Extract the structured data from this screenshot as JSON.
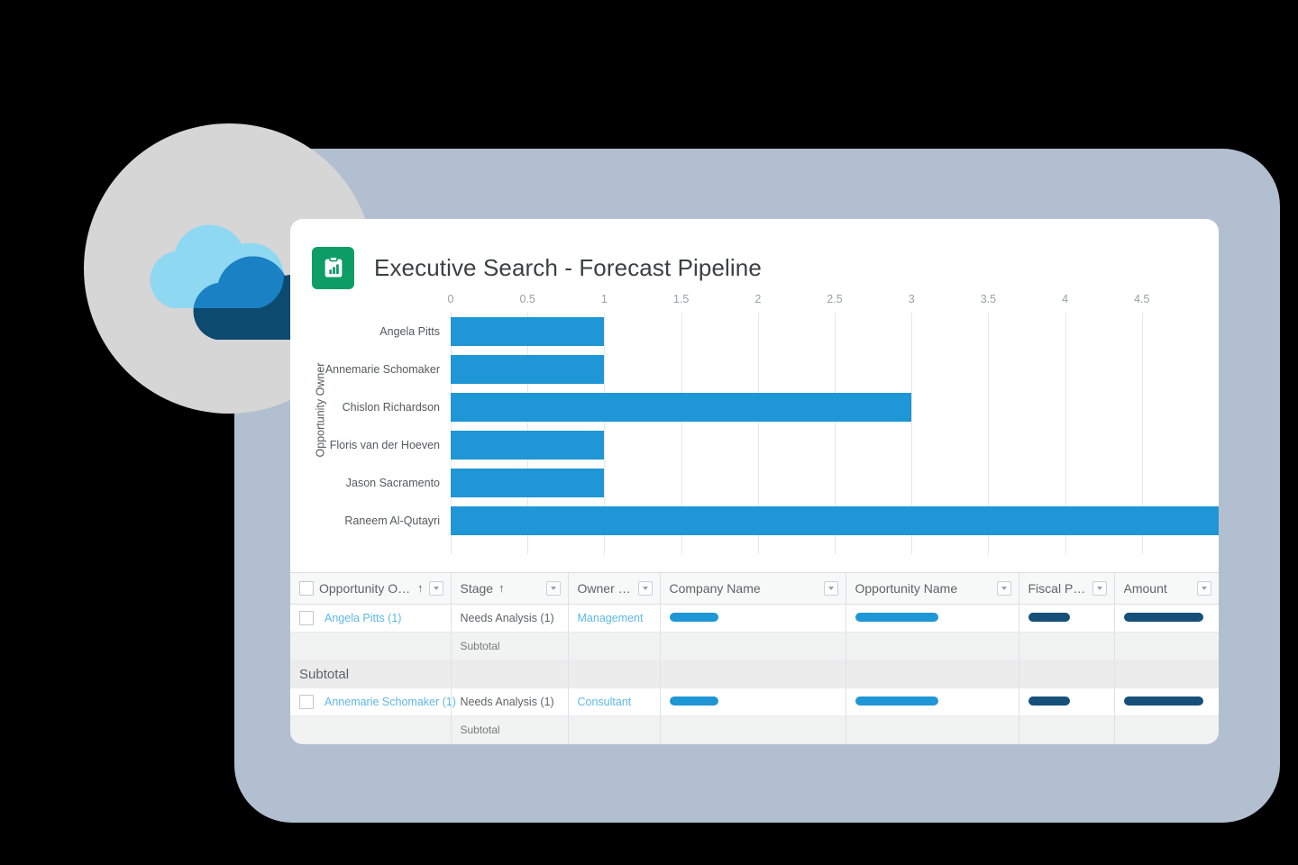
{
  "report": {
    "title": "Executive Search - Forecast Pipeline",
    "icon": "report-clipboard-chart-icon",
    "icon_color": "#0f9d67"
  },
  "theme": {
    "page_background": "#000000",
    "backdrop": "#b2bfd0",
    "circle": "#d6d6d6",
    "card": "#ffffff",
    "bar_blue": "#1f96d6",
    "link_blue": "#5db8e8",
    "pill_dark": "#165079",
    "cloud_light": "#8ed8f2",
    "cloud_mid": "#1a82c4",
    "cloud_dark": "#0d4a70"
  },
  "chart_data": {
    "type": "bar",
    "orientation": "horizontal",
    "title": "Executive Search - Forecast Pipeline",
    "xlabel": "",
    "ylabel": "Opportunity Owner",
    "xlim": [
      0,
      5
    ],
    "xticks": [
      "0",
      "0.5",
      "1",
      "1.5",
      "2",
      "2.5",
      "3",
      "3.5",
      "4",
      "4.5"
    ],
    "xtick_values": [
      0,
      0.5,
      1,
      1.5,
      2,
      2.5,
      3,
      3.5,
      4,
      4.5
    ],
    "grid": true,
    "legend": false,
    "categories": [
      "Angela Pitts",
      "Annemarie Schomaker",
      "Chislon Richardson",
      "Floris van der Hoeven",
      "Jason Sacramento",
      "Raneem Al-Qutayri"
    ],
    "values": [
      1,
      1,
      3,
      1,
      1,
      5
    ]
  },
  "table": {
    "columns": [
      {
        "label": "Opportunity Owner",
        "sorted": true,
        "sort_dir": "↑",
        "has_checkbox": true,
        "has_menu": true
      },
      {
        "label": "Stage",
        "sorted": true,
        "sort_dir": "↑",
        "has_checkbox": false,
        "has_menu": true
      },
      {
        "label": "Owner Role",
        "sorted": false,
        "sort_dir": "",
        "has_checkbox": false,
        "has_menu": true
      },
      {
        "label": "Company Name",
        "sorted": false,
        "sort_dir": "",
        "has_checkbox": false,
        "has_menu": true
      },
      {
        "label": "Opportunity Name",
        "sorted": false,
        "sort_dir": "",
        "has_checkbox": false,
        "has_menu": true
      },
      {
        "label": "Fiscal Period",
        "sorted": false,
        "sort_dir": "",
        "has_checkbox": false,
        "has_menu": true
      },
      {
        "label": "Amount",
        "sorted": false,
        "sort_dir": "",
        "has_checkbox": false,
        "has_menu": true
      }
    ],
    "rows": [
      {
        "kind": "data",
        "owner": "Angela Pitts (1)",
        "stage": "Needs Analysis (1)",
        "owner_role": "Management",
        "company_name": "redacted",
        "opportunity_name": "redacted",
        "fiscal_period": "redacted",
        "amount": "redacted"
      },
      {
        "kind": "subtotal",
        "stage": "Subtotal"
      },
      {
        "kind": "group-subtotal",
        "owner": "Subtotal"
      },
      {
        "kind": "data",
        "owner": "Annemarie Schomaker (1)",
        "stage": "Needs Analysis (1)",
        "owner_role": "Consultant",
        "company_name": "redacted",
        "opportunity_name": "redacted",
        "fiscal_period": "redacted",
        "amount": "redacted"
      },
      {
        "kind": "subtotal",
        "stage": "Subtotal"
      }
    ]
  }
}
